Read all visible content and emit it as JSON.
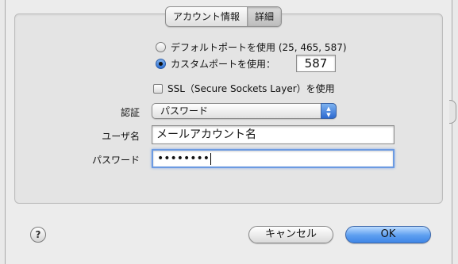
{
  "tabs": [
    {
      "label": "アカウント情報",
      "selected": false
    },
    {
      "label": "詳細",
      "selected": true
    }
  ],
  "ports": {
    "default_option": "デフォルトポートを使用 (25, 465, 587)",
    "custom_option": "カスタムポートを使用：",
    "custom_value": "587",
    "selected": "custom"
  },
  "ssl": {
    "label": "SSL（Secure Sockets Layer）を使用",
    "checked": false
  },
  "auth": {
    "label": "認証",
    "value": "パスワード"
  },
  "username": {
    "label": "ユーザ名",
    "value": "メールアカウント名"
  },
  "password": {
    "label": "パスワード",
    "value": "••••••••"
  },
  "buttons": {
    "help": "?",
    "cancel": "キャンセル",
    "ok": "OK"
  }
}
